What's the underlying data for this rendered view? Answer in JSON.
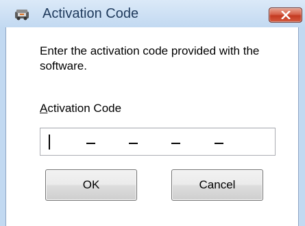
{
  "window": {
    "title": "Activation Code",
    "icon": "activation-app-icon",
    "close_icon": "close-icon"
  },
  "dialog": {
    "instruction": "Enter the activation code provided with the software.",
    "field_label_accel": "A",
    "field_label_rest": "ctivation Code",
    "code_value": "",
    "code_segments": 5,
    "code_separator": "-"
  },
  "buttons": {
    "ok_label": "OK",
    "cancel_label": "Cancel"
  }
}
